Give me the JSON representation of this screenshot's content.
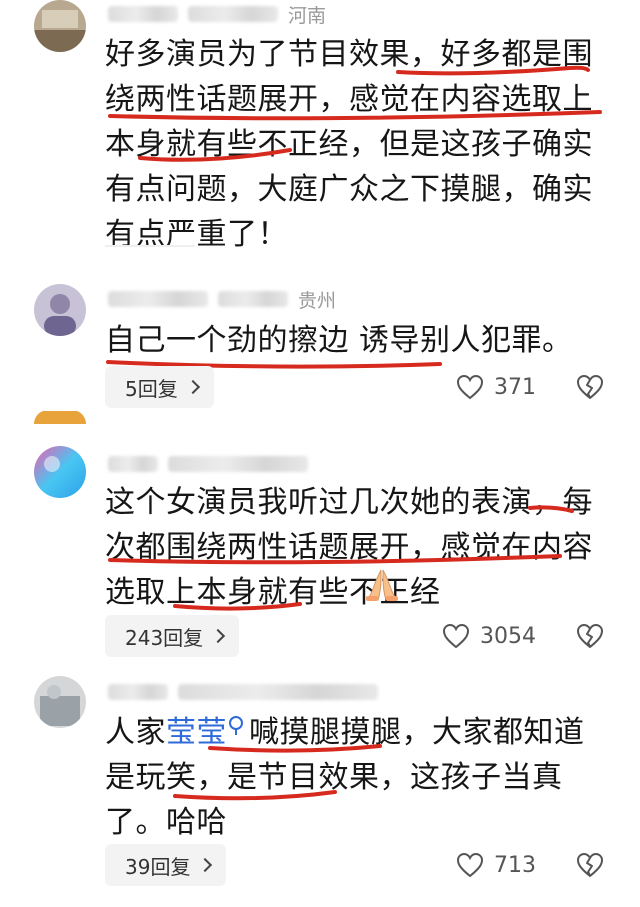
{
  "comments": [
    {
      "location": "河南",
      "text": "好多演员为了节目效果，好多都是围绕两性话题展开，感觉在内容选取上本身就有些不正经，但是这孩子确实有点问题，大庭广众之下摸腿，确实有点严重了！"
    },
    {
      "location": "贵州",
      "text": "自己一个劲的擦边 诱导别人犯罪。",
      "replies": "5回复",
      "likes": "371"
    },
    {
      "text": "这个女演员我听过几次她的表演，每次都围绕两性话题展开，感觉在内容选取上本身就有些不正经",
      "replies": "243回复",
      "likes": "3054"
    },
    {
      "text_before": "人家",
      "mention": "莹莹",
      "text_after": "喊摸腿摸腿，大家都知道是玩笑，是节目效果，这孩子当真了。哈哈",
      "replies": "39回复",
      "likes": "713"
    }
  ],
  "icons": {
    "like": "heart-outline-icon",
    "dislike": "broken-heart-icon",
    "reply_chevron": "chevron-right-icon",
    "mention": "search-icon",
    "emoji": "folded-hands-emoji"
  },
  "colors": {
    "underline": "#d62a1e",
    "mention": "#2f6bd8",
    "meta": "#9a9a9a",
    "pill_bg": "#f3f3f3"
  }
}
